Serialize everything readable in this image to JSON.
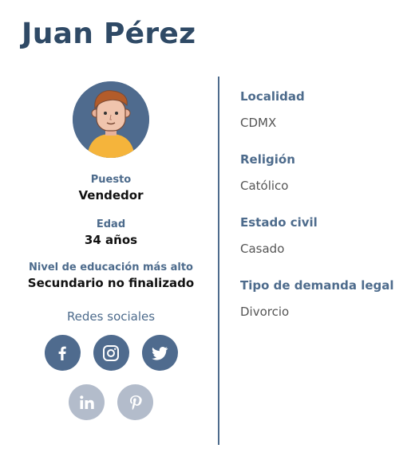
{
  "profile": {
    "name": "Juan Pérez",
    "puesto_label": "Puesto",
    "puesto_value": "Vendedor",
    "edad_label": "Edad",
    "edad_value": "34 años",
    "educacion_label": "Nivel de educación más alto",
    "educacion_value": "Secundario no finalizado"
  },
  "social": {
    "title": "Redes sociales",
    "networks": [
      {
        "name": "facebook-icon",
        "color": "#4f6b8e"
      },
      {
        "name": "instagram-icon",
        "color": "#4f6b8e"
      },
      {
        "name": "twitter-icon",
        "color": "#4f6b8e"
      },
      {
        "name": "linkedin-icon",
        "color": "#b3bccb"
      },
      {
        "name": "pinterest-icon",
        "color": "#b3bccb"
      }
    ]
  },
  "details": [
    {
      "label": "Localidad",
      "value": "CDMX"
    },
    {
      "label": "Religión",
      "value": "Católico"
    },
    {
      "label": "Estado civil",
      "value": "Casado"
    },
    {
      "label": "Tipo de demanda legal",
      "value": "Divorcio"
    }
  ],
  "colors": {
    "primary": "#2f4a66",
    "accent": "#4d6b8c",
    "muted": "#b3bccb"
  }
}
